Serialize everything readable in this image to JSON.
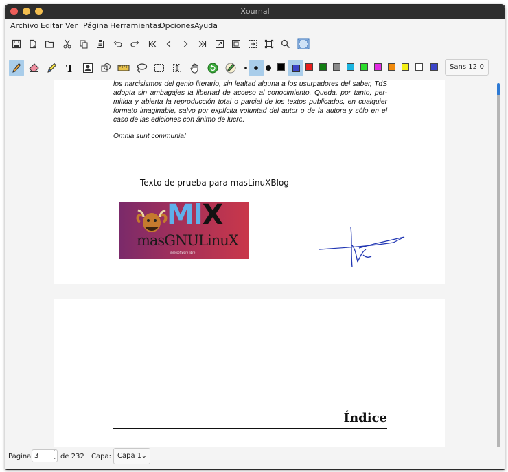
{
  "window": {
    "title": "Xournal"
  },
  "menu": [
    "Archivo",
    "Editar",
    "Ver",
    "Página",
    "Herramientas",
    "Opciones",
    "Ayuda"
  ],
  "toolbar_main": [
    "save-icon",
    "new-page-icon",
    "open-icon",
    "cut-icon",
    "copy-icon",
    "paste-icon",
    "undo-icon",
    "redo-icon",
    "first-page-icon",
    "prev-page-icon",
    "next-page-icon",
    "last-page-icon",
    "zoom-fit-icon",
    "zoom-page-icon",
    "zoom-width-icon",
    "zoom-100-icon",
    "search-icon",
    "fullscreen-icon"
  ],
  "toolbar_tools": [
    "pen-icon",
    "eraser-icon",
    "highlighter-icon",
    "text-icon",
    "image-icon",
    "shape-icon",
    "ruler-icon",
    "lasso-icon",
    "select-rect-icon",
    "vertical-space-icon",
    "hand-icon",
    "default-tool-icon",
    "pen-options-icon"
  ],
  "colors": {
    "active_tool_bg": "#a9cdea",
    "swatches": [
      "#000000",
      "#3b45c8",
      "#e81d1d",
      "#127d12",
      "#8a8a8a",
      "#1cb5e0",
      "#2bdd2b",
      "#e22ce2",
      "#f08a0c",
      "#f4f014",
      "#ffffff"
    ],
    "current_color": "#3b45c8",
    "signature_ink": "#2136b3"
  },
  "font_button": {
    "font": "Sans 12",
    "size": "0"
  },
  "page1": {
    "paragraph_lines": [
      "los narcisismos del genio literario, sin lealtad alguna a los usurpadores del saber, TdS",
      "adopta sin ambagajes la libertad de acceso al conocimiento. Queda, por tanto, per-",
      "mitida y abierta la reproducción total o parcial de los textos publicados, en cualquier",
      "formato imaginable, salvo por explícita voluntad del autor o de la autora y sólo en el",
      "caso de las ediciones con ánimo de lucro."
    ],
    "closing_line": "Omnia sunt communia!",
    "test_text": "Texto de prueba para masLinuXBlog",
    "logo": {
      "ml": "Ml",
      "x": "X",
      "gnu": "masGNULinuX",
      "sub": "libre software libre"
    }
  },
  "page2": {
    "heading": "Índice"
  },
  "status": {
    "page_label": "Página",
    "page_value": "3",
    "of_label": "de 232",
    "layer_label": "Capa:",
    "layer_value": "Capa 1"
  }
}
